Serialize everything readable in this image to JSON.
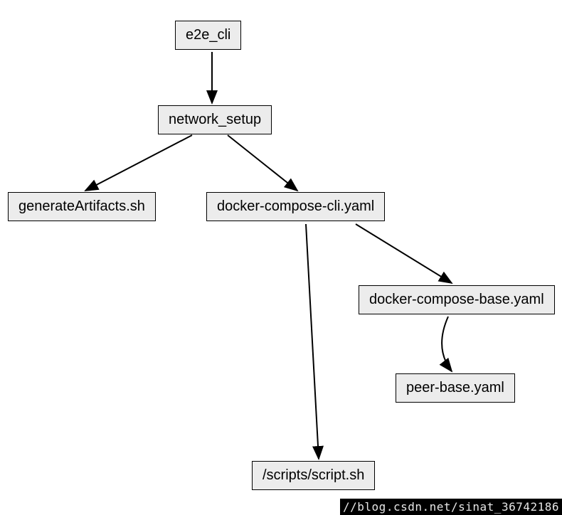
{
  "nodes": {
    "root": "e2e_cli",
    "network_setup": "network_setup",
    "generate_artifacts": "generateArtifacts.sh",
    "docker_compose_cli": "docker-compose-cli.yaml",
    "docker_compose_base": "docker-compose-base.yaml",
    "peer_base": "peer-base.yaml",
    "script": "/scripts/script.sh"
  },
  "watermark": "//blog.csdn.net/sinat_36742186"
}
